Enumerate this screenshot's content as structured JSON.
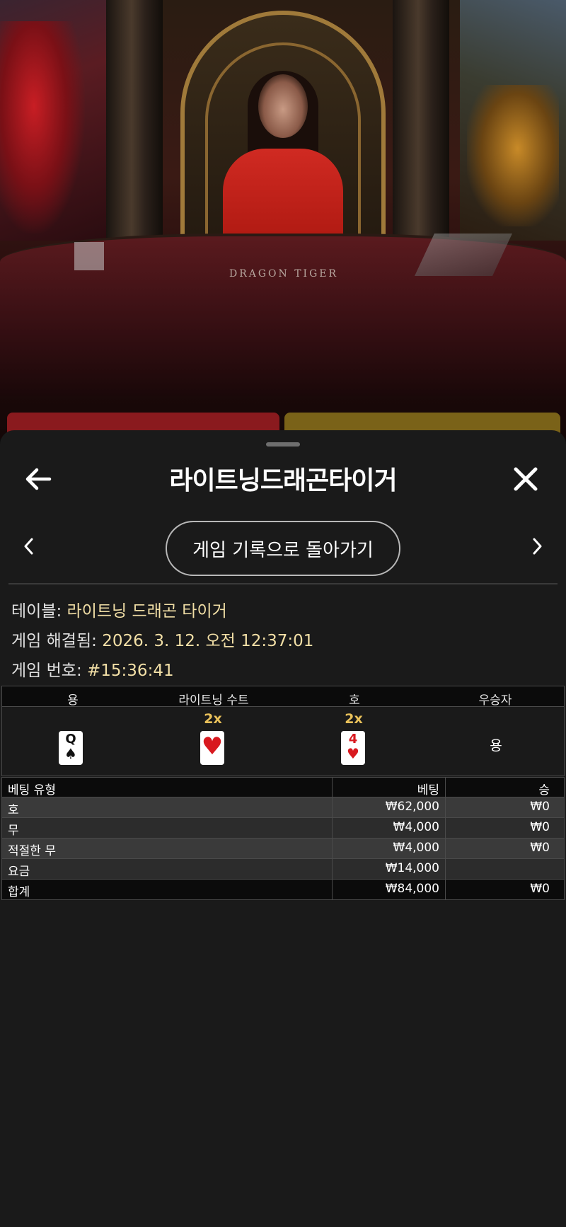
{
  "video": {
    "table_logo_text": "DRAGON TIGER"
  },
  "sheet": {
    "title": "라이트닝드래곤타이거",
    "return_button_label": "게임 기록으로 돌아가기",
    "info": {
      "table_label": "테이블:",
      "table_value": "라이트닝 드래곤 타이거",
      "resolved_label": "게임 해결됨:",
      "resolved_value": "2026. 3. 12. 오전 12:37:01",
      "number_label": "게임 번호:",
      "number_value": "#15:36:41"
    },
    "result": {
      "columns": [
        "용",
        "라이트닝 수트",
        "호",
        "우승자"
      ],
      "dragon_card": {
        "rank": "Q",
        "suit": "♠"
      },
      "lightning_multiplier": "2x",
      "lightning_card": {
        "rank": "",
        "suit": "♥"
      },
      "tiger_multiplier": "2x",
      "tiger_card": {
        "rank": "4",
        "suit": "♥"
      },
      "winner": "용"
    },
    "bets": {
      "headers": [
        "베팅 유형",
        "베팅",
        "승"
      ],
      "rows": [
        {
          "type": "호",
          "bet": "₩62,000",
          "win": "₩0"
        },
        {
          "type": "무",
          "bet": "₩4,000",
          "win": "₩0"
        },
        {
          "type": "적절한 무",
          "bet": "₩4,000",
          "win": "₩0"
        },
        {
          "type": "요금",
          "bet": "₩14,000",
          "win": ""
        },
        {
          "type": "합계",
          "bet": "₩84,000",
          "win": "₩0"
        }
      ]
    },
    "colors": {
      "sheet_bg": "#1a1a1a",
      "value_text": "#f2dfa6",
      "multiplier": "#e9c15a",
      "red_suit": "#d8191f"
    },
    "icons": {
      "back": "arrow-left-icon",
      "close": "close-icon",
      "prev": "chevron-left-icon",
      "next": "chevron-right-icon"
    }
  }
}
